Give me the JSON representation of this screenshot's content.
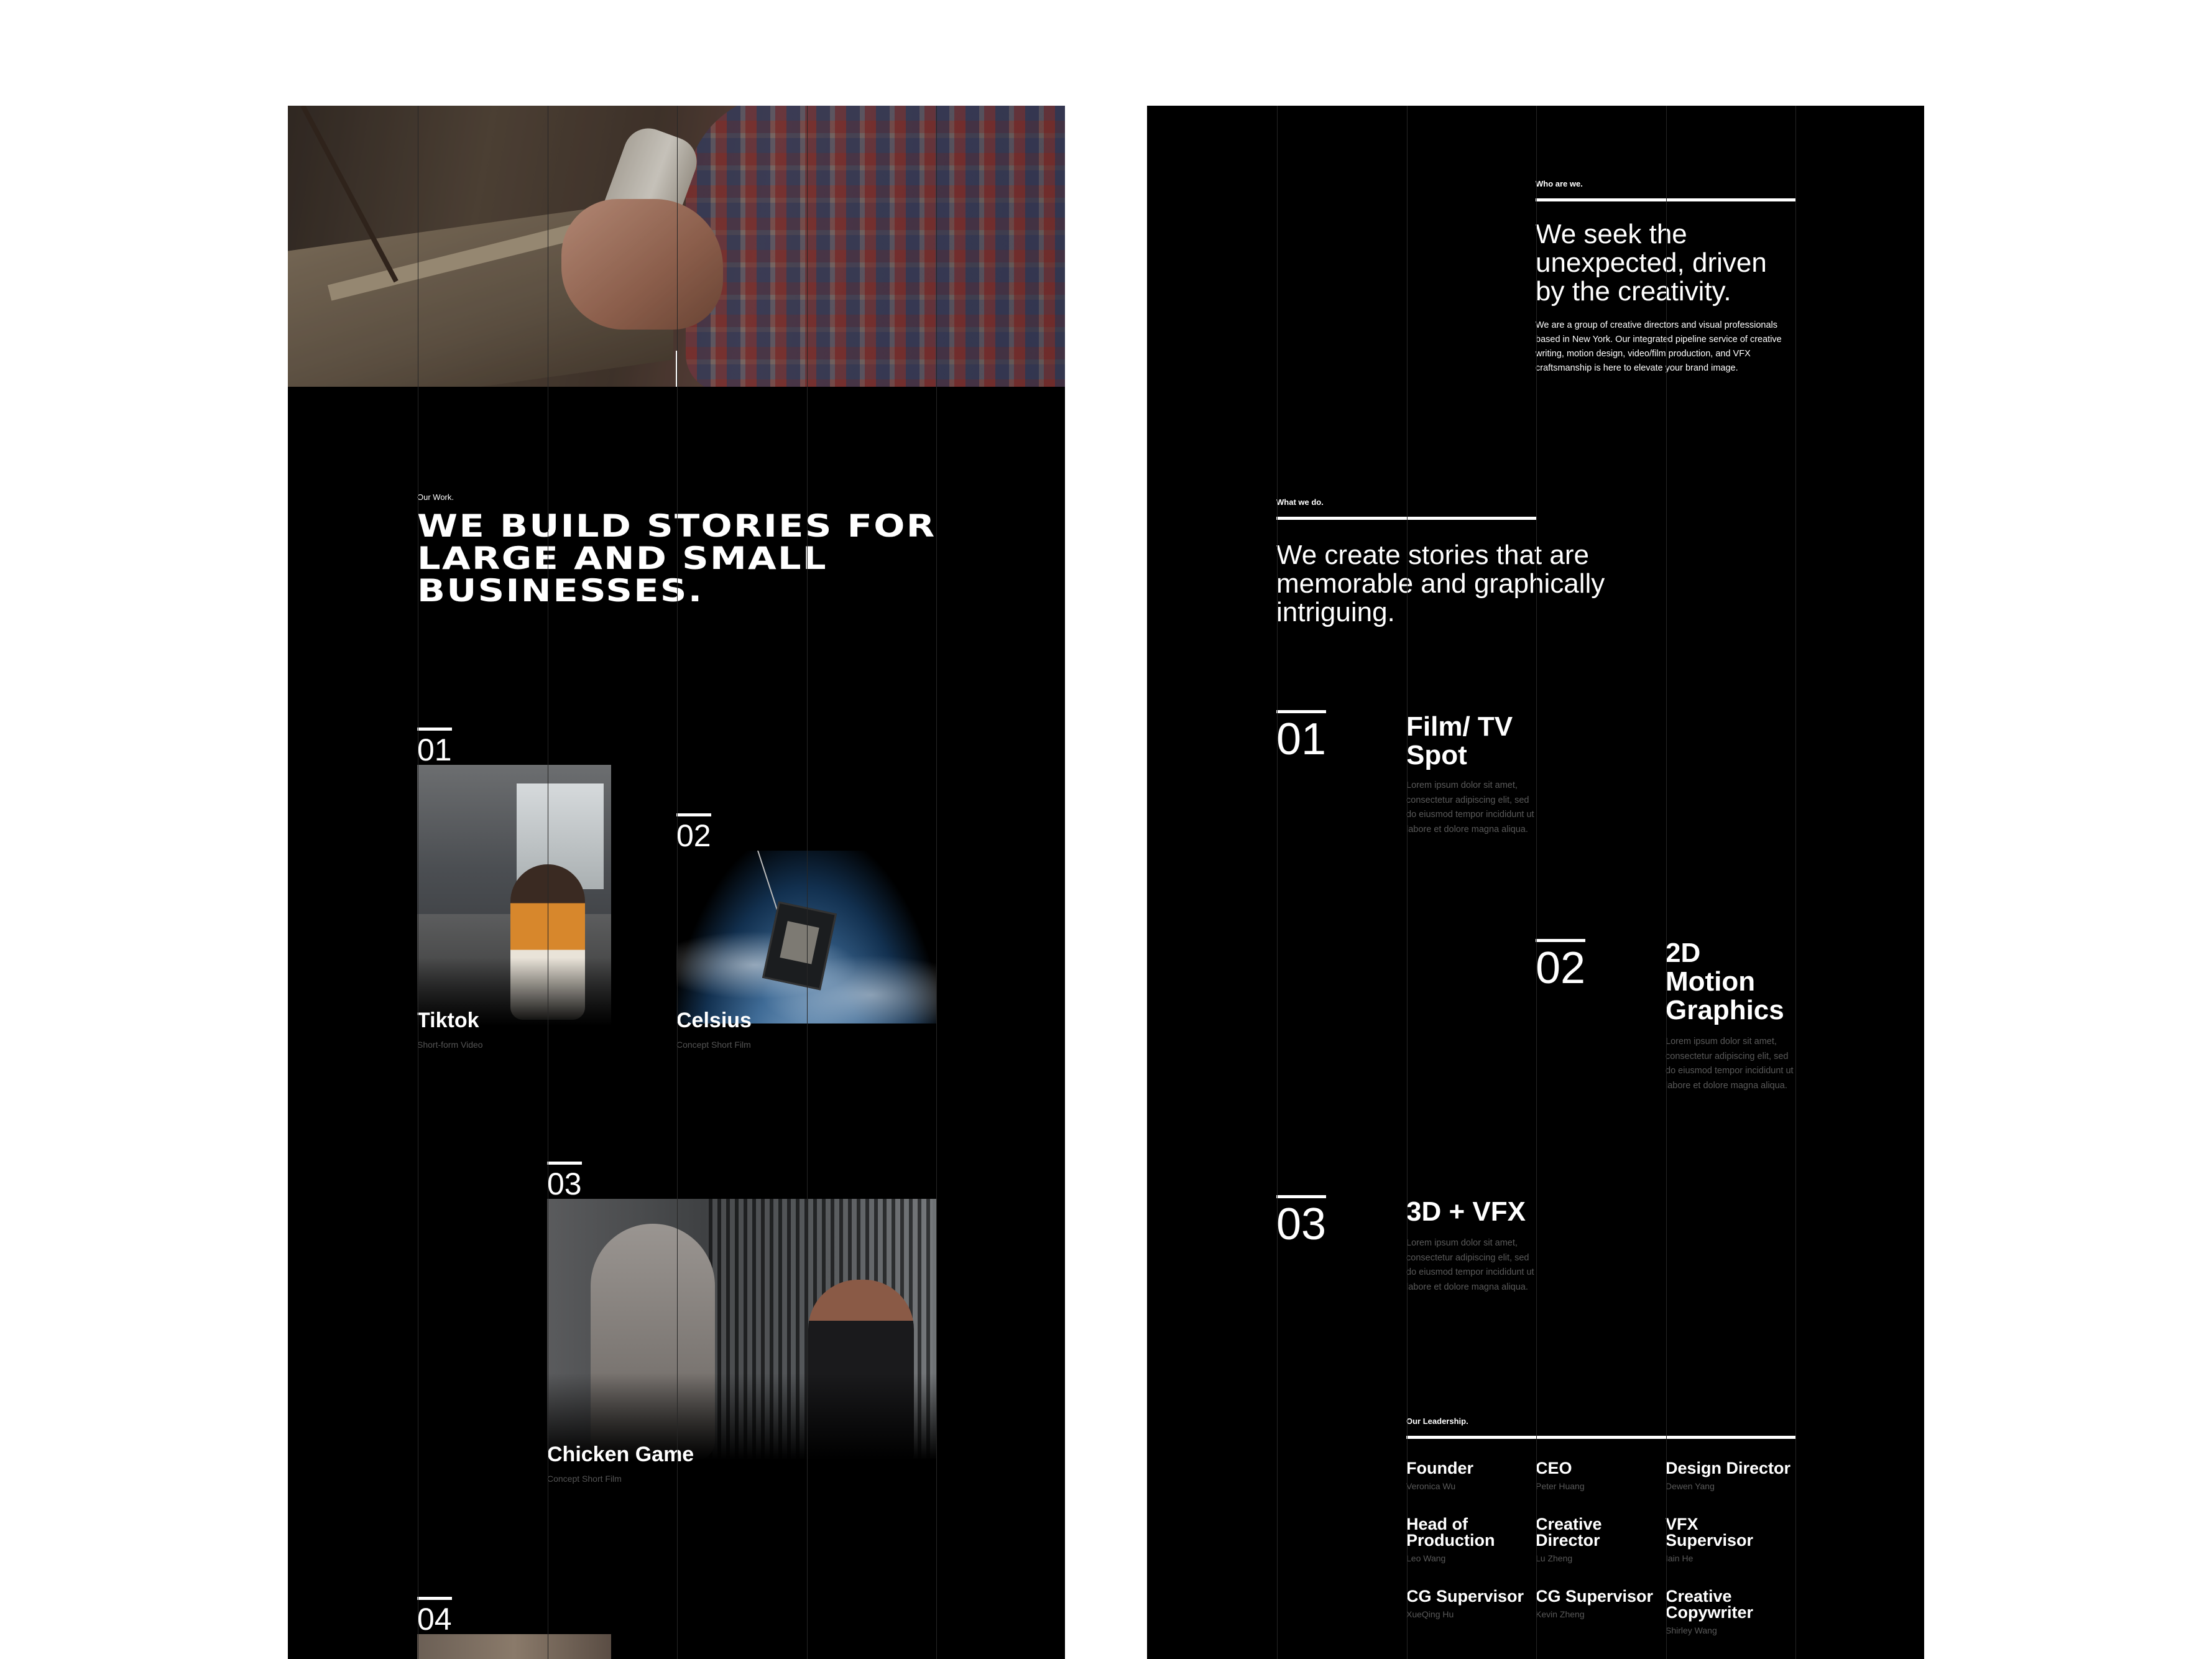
{
  "left": {
    "work_label": "Our Work.",
    "headline": "WE BUILD STORIES FOR LARGE AND SMALL BUSINESSES.",
    "projects": [
      {
        "number": "01",
        "title": "Tiktok",
        "subtitle": "Short-form Video"
      },
      {
        "number": "02",
        "title": "Celsius",
        "subtitle": "Concept Short Film"
      },
      {
        "number": "03",
        "title": "Chicken Game",
        "subtitle": "Concept Short Film"
      },
      {
        "number": "04"
      }
    ]
  },
  "right": {
    "who_label": "Who are we.",
    "who_heading": "We seek the unexpected, driven by the creativity.",
    "who_body": "We are a group of creative directors and visual professionals based in New York. Our integrated pipeline service of creative writing, motion design, video/film production, and VFX craftsmanship is here to elevate your brand image.",
    "what_label": "What we do.",
    "what_heading": "We create stories that are memorable and graphically intriguing.",
    "services": [
      {
        "number": "01",
        "title": "Film/ TV Spot",
        "description": "Lorem ipsum dolor sit amet, consectetur adipiscing elit, sed do eiusmod tempor incididunt ut labore et dolore magna aliqua."
      },
      {
        "number": "02",
        "title": "2D Motion Graphics",
        "description": "Lorem ipsum dolor sit amet, consectetur adipiscing elit, sed do eiusmod tempor incididunt ut labore et dolore magna aliqua."
      },
      {
        "number": "03",
        "title": "3D + VFX",
        "description": "Lorem ipsum dolor sit amet, consectetur adipiscing elit, sed do eiusmod tempor incididunt ut labore et dolore magna aliqua."
      }
    ],
    "leadership_label": "Our Leadership.",
    "leaders": [
      {
        "role": "Founder",
        "name": "Veronica Wu"
      },
      {
        "role": "CEO",
        "name": "Peter Huang"
      },
      {
        "role": "Design Director",
        "name": "Dewen Yang"
      },
      {
        "role": "Head of Production",
        "name": "Leo Wang"
      },
      {
        "role": "Creative Director",
        "name": "Lu Zheng"
      },
      {
        "role": "VFX Supervisor",
        "name": "Iain He"
      },
      {
        "role": "CG Supervisor",
        "name": "XueQing Hu"
      },
      {
        "role": "CG Supervisor",
        "name": "Kevin Zheng"
      },
      {
        "role": "Creative Copywriter",
        "name": "Shirley Wang"
      }
    ]
  }
}
